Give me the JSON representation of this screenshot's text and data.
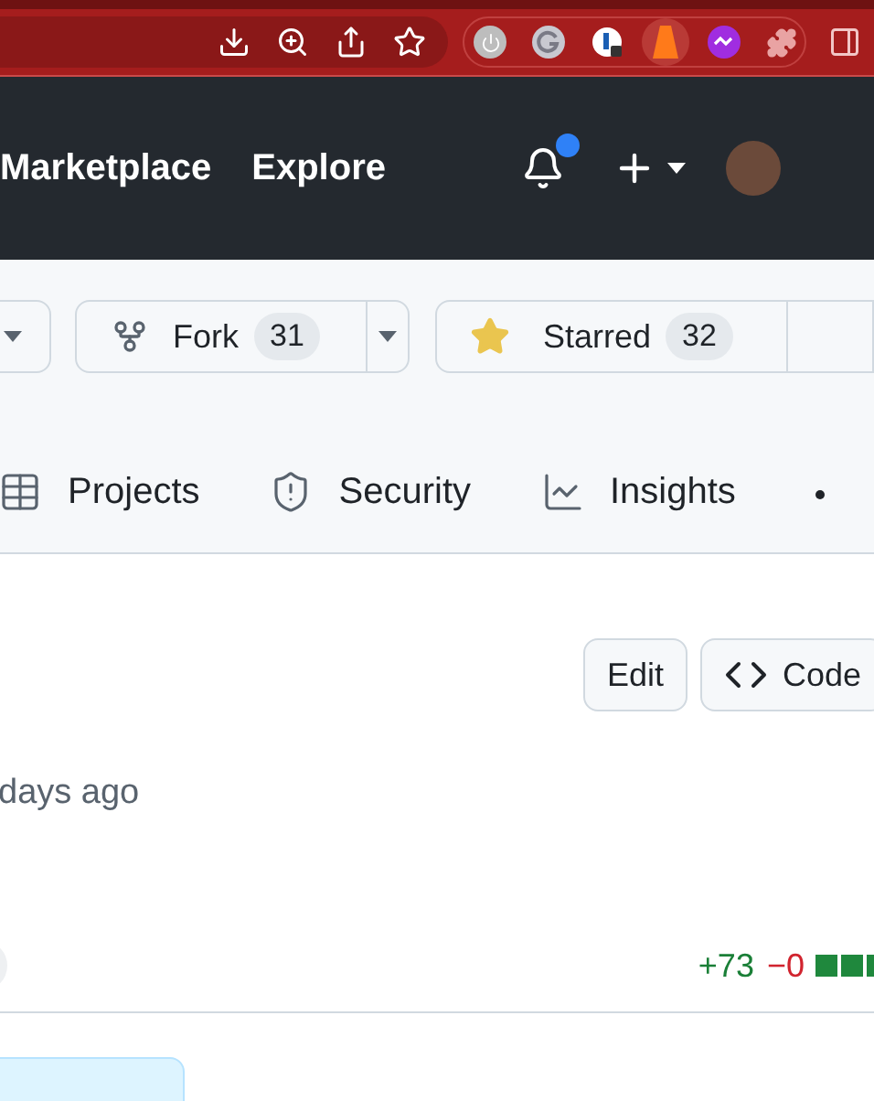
{
  "header": {
    "nav": [
      {
        "label": "Marketplace"
      },
      {
        "label": "Explore"
      }
    ],
    "notifications_unread": true
  },
  "repo_actions": {
    "fork": {
      "label": "Fork",
      "count": "31"
    },
    "star": {
      "label": "Starred",
      "count": "32",
      "starred": true
    }
  },
  "tabs": [
    {
      "kind": "projects",
      "label": "Projects",
      "selected": false
    },
    {
      "kind": "security",
      "label": "Security",
      "selected": false
    },
    {
      "kind": "insights",
      "label": "Insights",
      "selected": false
    }
  ],
  "file_actions": [
    {
      "kind": "edit",
      "label": "Edit"
    },
    {
      "kind": "code",
      "label": "Code"
    }
  ],
  "commit": {
    "time": "days ago"
  },
  "diffstat": {
    "additions": "+73",
    "deletions": "−0",
    "blocks": [
      {
        "kind": "added"
      },
      {
        "kind": "added"
      },
      {
        "kind": "added"
      }
    ]
  }
}
